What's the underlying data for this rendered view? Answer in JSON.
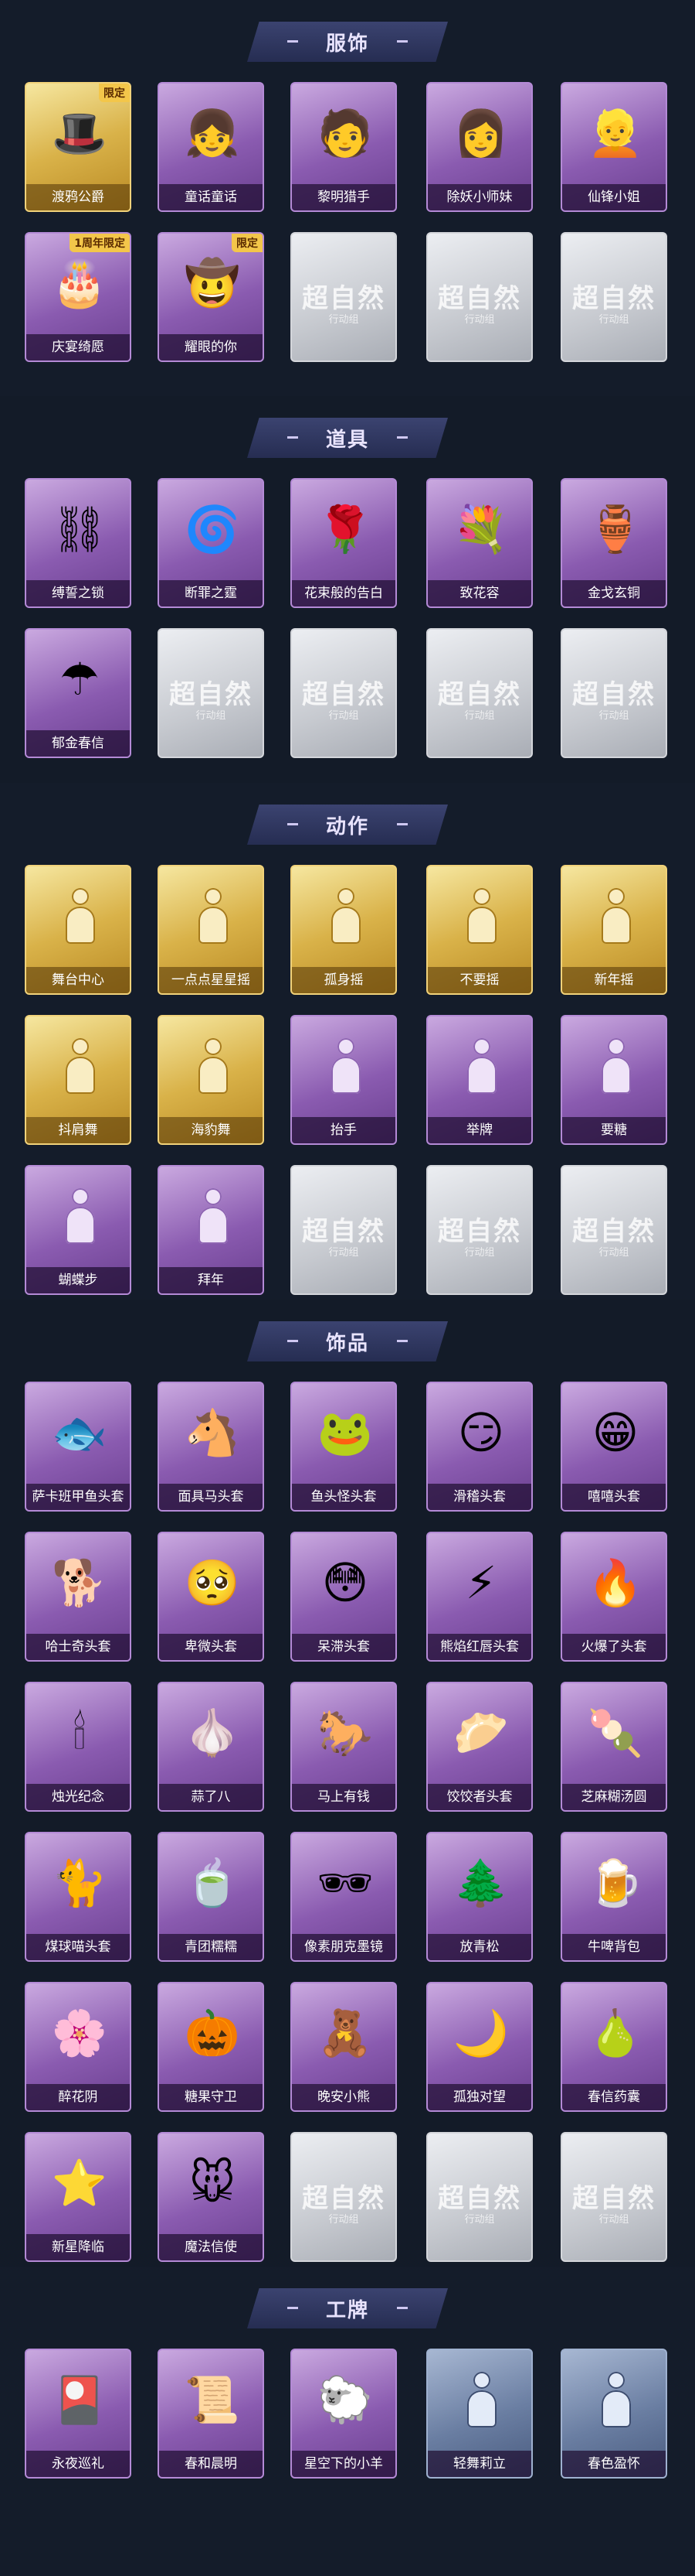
{
  "sections": [
    {
      "title": "服饰",
      "items": [
        {
          "label": "渡鸦公爵",
          "style": "gold",
          "badge": "限定",
          "icon": "🎩"
        },
        {
          "label": "童话童话",
          "style": "purple",
          "badge": "",
          "icon": "👧"
        },
        {
          "label": "黎明猎手",
          "style": "purple",
          "badge": "",
          "icon": "🧑"
        },
        {
          "label": "除妖小师妹",
          "style": "purple",
          "badge": "",
          "icon": "👩"
        },
        {
          "label": "仙锋小姐",
          "style": "purple",
          "badge": "",
          "icon": "👱"
        },
        {
          "label": "庆宴绮愿",
          "style": "purple",
          "badge": "1周年限定",
          "icon": "🎂"
        },
        {
          "label": "耀眼的你",
          "style": "purple",
          "badge": "限定",
          "icon": "🤠"
        },
        {
          "label": "",
          "style": "gray",
          "badge": "",
          "icon": "",
          "placeholder": "超自然",
          "placeholder_sub": "行动组"
        },
        {
          "label": "",
          "style": "gray",
          "badge": "",
          "icon": "",
          "placeholder": "超自然",
          "placeholder_sub": "行动组"
        },
        {
          "label": "",
          "style": "gray",
          "badge": "",
          "icon": "",
          "placeholder": "超自然",
          "placeholder_sub": "行动组"
        }
      ]
    },
    {
      "title": "道具",
      "items": [
        {
          "label": "缚誓之锁",
          "style": "purple",
          "icon": "⛓"
        },
        {
          "label": "断罪之霆",
          "style": "purple",
          "icon": "🌀"
        },
        {
          "label": "花束般的告白",
          "style": "purple",
          "icon": "🌹"
        },
        {
          "label": "致花容",
          "style": "purple",
          "icon": "💐"
        },
        {
          "label": "金戈玄铜",
          "style": "purple",
          "icon": "🏺"
        },
        {
          "label": "郁金春信",
          "style": "purple",
          "icon": "☂"
        },
        {
          "label": "",
          "style": "gray",
          "icon": "",
          "placeholder": "超自然",
          "placeholder_sub": "行动组"
        },
        {
          "label": "",
          "style": "gray",
          "icon": "",
          "placeholder": "超自然",
          "placeholder_sub": "行动组"
        },
        {
          "label": "",
          "style": "gray",
          "icon": "",
          "placeholder": "超自然",
          "placeholder_sub": "行动组"
        },
        {
          "label": "",
          "style": "gray",
          "icon": "",
          "placeholder": "超自然",
          "placeholder_sub": "行动组"
        }
      ]
    },
    {
      "title": "动作",
      "items": [
        {
          "label": "舞台中心",
          "style": "gold",
          "icon": "silhouette"
        },
        {
          "label": "一点点星星摇",
          "style": "gold",
          "icon": "silhouette"
        },
        {
          "label": "孤身摇",
          "style": "gold",
          "icon": "silhouette"
        },
        {
          "label": "不要摇",
          "style": "gold",
          "icon": "silhouette"
        },
        {
          "label": "新年摇",
          "style": "gold",
          "icon": "silhouette"
        },
        {
          "label": "抖肩舞",
          "style": "gold",
          "icon": "silhouette"
        },
        {
          "label": "海豹舞",
          "style": "gold",
          "icon": "silhouette"
        },
        {
          "label": "抬手",
          "style": "purple",
          "icon": "silhouette"
        },
        {
          "label": "举牌",
          "style": "purple",
          "icon": "silhouette"
        },
        {
          "label": "要糖",
          "style": "purple",
          "icon": "silhouette"
        },
        {
          "label": "蝴蝶步",
          "style": "purple",
          "icon": "silhouette"
        },
        {
          "label": "拜年",
          "style": "purple",
          "icon": "silhouette"
        },
        {
          "label": "",
          "style": "gray",
          "icon": "",
          "placeholder": "超自然",
          "placeholder_sub": "行动组"
        },
        {
          "label": "",
          "style": "gray",
          "icon": "",
          "placeholder": "超自然",
          "placeholder_sub": "行动组"
        },
        {
          "label": "",
          "style": "gray",
          "icon": "",
          "placeholder": "超自然",
          "placeholder_sub": "行动组"
        }
      ]
    },
    {
      "title": "饰品",
      "items": [
        {
          "label": "萨卡班甲鱼头套",
          "style": "purple",
          "icon": "🐟"
        },
        {
          "label": "面具马头套",
          "style": "purple",
          "icon": "🐴"
        },
        {
          "label": "鱼头怪头套",
          "style": "purple",
          "icon": "🐸"
        },
        {
          "label": "滑稽头套",
          "style": "purple",
          "icon": "😏"
        },
        {
          "label": "嘻嘻头套",
          "style": "purple",
          "icon": "😁"
        },
        {
          "label": "哈士奇头套",
          "style": "purple",
          "icon": "🐕"
        },
        {
          "label": "卑微头套",
          "style": "purple",
          "icon": "🥺"
        },
        {
          "label": "呆滞头套",
          "style": "purple",
          "icon": "😳"
        },
        {
          "label": "熊焰红唇头套",
          "style": "purple",
          "icon": "⚡"
        },
        {
          "label": "火爆了头套",
          "style": "purple",
          "icon": "🔥"
        },
        {
          "label": "烛光纪念",
          "style": "purple",
          "icon": "🕯"
        },
        {
          "label": "蒜了八",
          "style": "purple",
          "icon": "🧄"
        },
        {
          "label": "马上有钱",
          "style": "purple",
          "icon": "🐎"
        },
        {
          "label": "饺饺者头套",
          "style": "purple",
          "icon": "🥟"
        },
        {
          "label": "芝麻糊汤圆",
          "style": "purple",
          "icon": "🍡"
        },
        {
          "label": "煤球喵头套",
          "style": "purple",
          "icon": "🐈"
        },
        {
          "label": "青团糯糯",
          "style": "purple",
          "icon": "🍵"
        },
        {
          "label": "像素朋克墨镜",
          "style": "purple",
          "icon": "🕶"
        },
        {
          "label": "放青松",
          "style": "purple",
          "icon": "🌲"
        },
        {
          "label": "牛啤背包",
          "style": "purple",
          "icon": "🍺"
        },
        {
          "label": "醉花阴",
          "style": "purple",
          "icon": "🌸"
        },
        {
          "label": "糖果守卫",
          "style": "purple",
          "icon": "🎃"
        },
        {
          "label": "晚安小熊",
          "style": "purple",
          "icon": "🧸"
        },
        {
          "label": "孤独对望",
          "style": "purple",
          "icon": "🌙"
        },
        {
          "label": "春信药囊",
          "style": "purple",
          "icon": "🍐"
        },
        {
          "label": "新星降临",
          "style": "purple",
          "icon": "⭐"
        },
        {
          "label": "魔法信使",
          "style": "purple",
          "icon": "🐭"
        },
        {
          "label": "",
          "style": "gray",
          "icon": "",
          "placeholder": "超自然",
          "placeholder_sub": "行动组"
        },
        {
          "label": "",
          "style": "gray",
          "icon": "",
          "placeholder": "超自然",
          "placeholder_sub": "行动组"
        },
        {
          "label": "",
          "style": "gray",
          "icon": "",
          "placeholder": "超自然",
          "placeholder_sub": "行动组"
        }
      ]
    },
    {
      "title": "工牌",
      "items": [
        {
          "label": "永夜巡礼",
          "style": "purple",
          "icon": "🎴"
        },
        {
          "label": "春和晨明",
          "style": "purple",
          "icon": "📜"
        },
        {
          "label": "星空下的小羊",
          "style": "purple",
          "icon": "🐑"
        },
        {
          "label": "轻舞莉立",
          "style": "blue",
          "icon": "silhouette"
        },
        {
          "label": "春色盈怀",
          "style": "blue",
          "icon": "silhouette"
        }
      ]
    }
  ]
}
